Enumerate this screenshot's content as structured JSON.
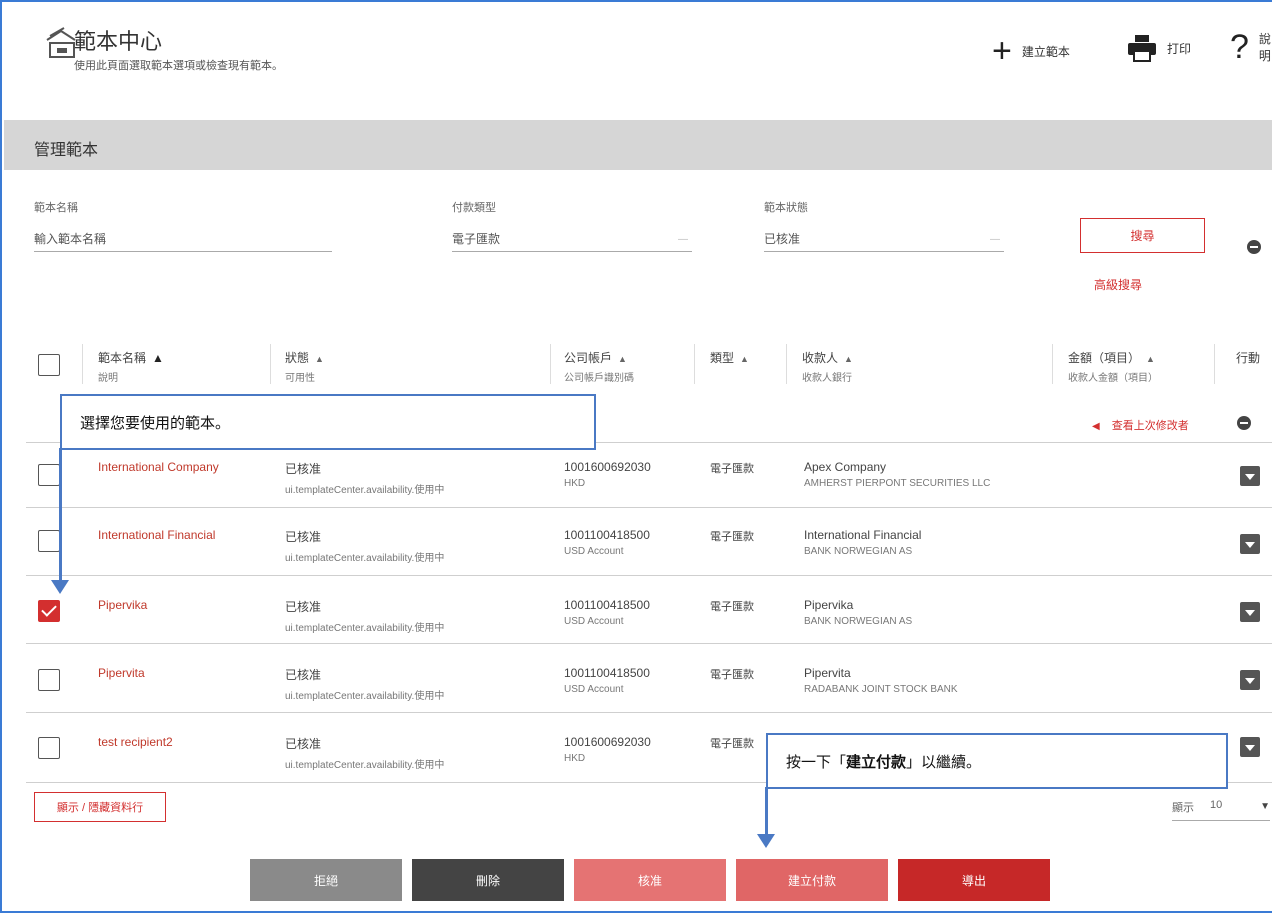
{
  "header": {
    "title": "範本中心",
    "subtitle": "使用此頁面選取範本選項或檢查現有範本。",
    "actions": {
      "create_template": "建立範本",
      "print": "打印",
      "help": "說明"
    }
  },
  "section": {
    "title": "管理範本"
  },
  "filters": {
    "template_name": {
      "label": "範本名稱",
      "placeholder": "輸入範本名稱"
    },
    "payment_type": {
      "label": "付款類型",
      "value": "電子匯款"
    },
    "template_status": {
      "label": "範本狀態",
      "value": "已核准"
    },
    "search_label": "搜尋",
    "advanced_search_label": "高級搜尋"
  },
  "table": {
    "columns": [
      {
        "title": "範本名稱",
        "sub": "說明"
      },
      {
        "title": "狀態",
        "sub": "可用性"
      },
      {
        "title": "公司帳戶",
        "sub": "公司帳戶識別碼"
      },
      {
        "title": "類型",
        "sub": ""
      },
      {
        "title": "收款人",
        "sub": "收款人銀行"
      },
      {
        "title": "金額（項目）",
        "sub": "收款人金額（項目）"
      },
      {
        "title": "行動",
        "sub": ""
      }
    ],
    "last_modified_link": "查看上次修改者",
    "rows": [
      {
        "name": "International Company",
        "status": "已核准",
        "availability": "ui.templateCenter.availability.使用中",
        "account": "1001600692030",
        "account_id": "HKD",
        "type": "電子匯款",
        "payee": "Apex Company",
        "payee_bank": "AMHERST PIERPONT SECURITIES LLC",
        "checked": false
      },
      {
        "name": "International Financial",
        "status": "已核准",
        "availability": "ui.templateCenter.availability.使用中",
        "account": "1001100418500",
        "account_id": "USD Account",
        "type": "電子匯款",
        "payee": "International Financial",
        "payee_bank": "BANK NORWEGIAN AS",
        "checked": false
      },
      {
        "name": "Pipervika",
        "status": "已核准",
        "availability": "ui.templateCenter.availability.使用中",
        "account": "1001100418500",
        "account_id": "USD Account",
        "type": "電子匯款",
        "payee": "Pipervika",
        "payee_bank": "BANK NORWEGIAN AS",
        "checked": true
      },
      {
        "name": "Pipervita",
        "status": "已核准",
        "availability": "ui.templateCenter.availability.使用中",
        "account": "1001100418500",
        "account_id": "USD Account",
        "type": "電子匯款",
        "payee": "Pipervita",
        "payee_bank": "RADABANK JOINT STOCK BANK",
        "checked": false
      },
      {
        "name": "test recipient2",
        "status": "已核准",
        "availability": "ui.templateCenter.availability.使用中",
        "account": "1001600692030",
        "account_id": "HKD",
        "type": "電子匯款",
        "payee": "",
        "payee_bank": "",
        "checked": false
      }
    ]
  },
  "footer": {
    "show_hide_columns": "顯示 / 隱藏資料行",
    "page_size_label": "顯示",
    "page_size_value": "10"
  },
  "buttons": {
    "reject": "拒絕",
    "delete": "刪除",
    "approve": "核准",
    "create_payment": "建立付款",
    "export": "導出"
  },
  "callouts": {
    "select_template": "選擇您要使用的範本。",
    "create_payment_prefix": "按一下「",
    "create_payment_bold": "建立付款",
    "create_payment_suffix": "」以繼續。"
  },
  "colors": {
    "accent": "#d32f2f",
    "callout_border": "#4a79c4",
    "gray_btn": "#8a8a8a",
    "dark_btn": "#444444",
    "light_red_btn": "#e57373"
  }
}
